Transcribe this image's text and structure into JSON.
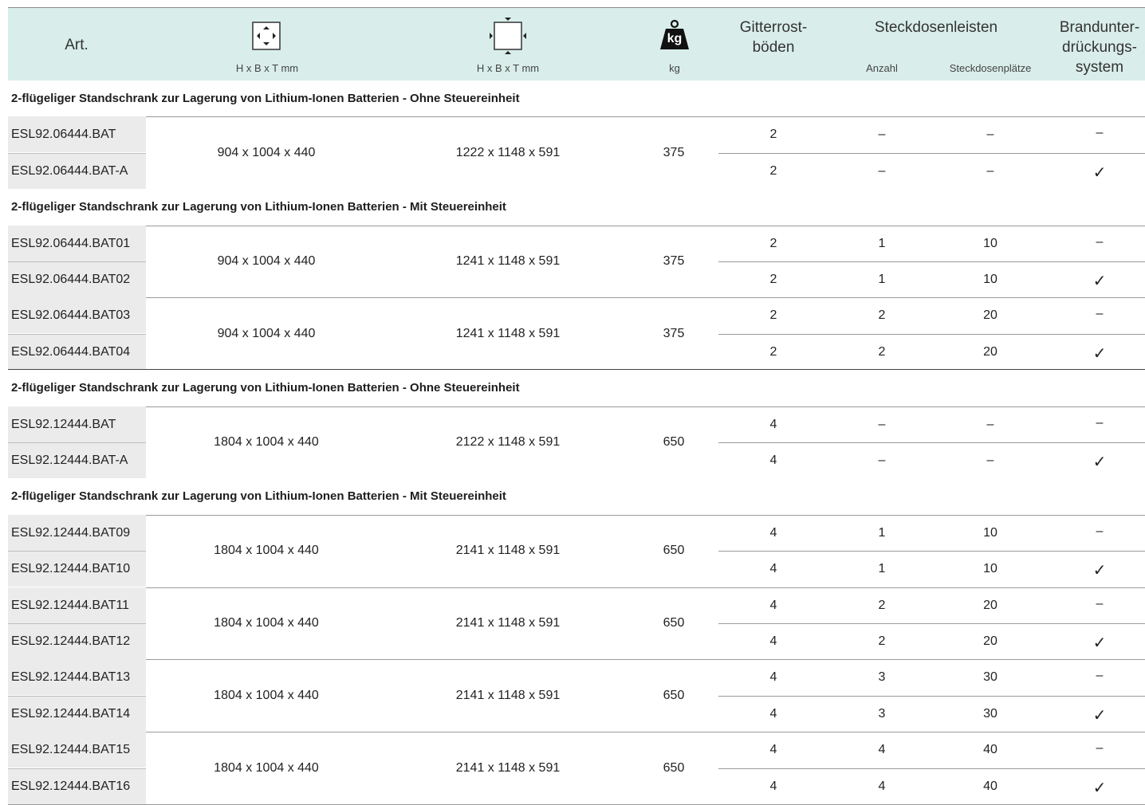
{
  "header": {
    "art": "Art.",
    "dim_inner_label": "H x B x T mm",
    "dim_outer_label": "H x B x T mm",
    "weight_icon_text": "kg",
    "weight_label": "kg",
    "shelves_line1": "Gitterrost-",
    "shelves_line2": "böden",
    "sockets_title": "Steckdosenleisten",
    "sockets_count": "Anzahl",
    "sockets_places": "Steckdosenplätze",
    "fire_line1": "Brandunter-",
    "fire_line2": "drückungs-",
    "fire_line3": "system"
  },
  "groups": [
    "2-flügeliger Standschrank zur Lagerung von Lithium-Ionen Batterien - Ohne Steuereinheit",
    "2-flügeliger Standschrank zur Lagerung von Lithium-Ionen Batterien - Mit Steuereinheit",
    "2-flügeliger Standschrank zur Lagerung von Lithium-Ionen Batterien - Ohne Steuereinheit",
    "2-flügeliger Standschrank zur Lagerung von Lithium-Ionen Batterien - Mit Steuereinheit"
  ],
  "pairs": [
    {
      "inner": "904 x 1004 x 440",
      "outer": "1222 x 1148 x 591",
      "weight": "375"
    },
    {
      "inner": "904 x 1004 x 440",
      "outer": "1241 x 1148 x 591",
      "weight": "375"
    },
    {
      "inner": "904 x 1004 x 440",
      "outer": "1241 x 1148 x 591",
      "weight": "375"
    },
    {
      "inner": "1804 x 1004 x 440",
      "outer": "2122 x 1148 x 591",
      "weight": "650"
    },
    {
      "inner": "1804 x 1004 x 440",
      "outer": "2141 x 1148 x 591",
      "weight": "650"
    },
    {
      "inner": "1804 x 1004 x 440",
      "outer": "2141 x 1148 x 591",
      "weight": "650"
    },
    {
      "inner": "1804 x 1004 x 440",
      "outer": "2141 x 1148 x 591",
      "weight": "650"
    },
    {
      "inner": "1804 x 1004 x 440",
      "outer": "2141 x 1148 x 591",
      "weight": "650"
    }
  ],
  "rows": [
    {
      "art": "ESL92.06444.BAT",
      "shelves": "2",
      "count": "–",
      "places": "–",
      "fire": "–"
    },
    {
      "art": "ESL92.06444.BAT-A",
      "shelves": "2",
      "count": "–",
      "places": "–",
      "fire": "✓"
    },
    {
      "art": "ESL92.06444.BAT01",
      "shelves": "2",
      "count": "1",
      "places": "10",
      "fire": "–"
    },
    {
      "art": "ESL92.06444.BAT02",
      "shelves": "2",
      "count": "1",
      "places": "10",
      "fire": "✓"
    },
    {
      "art": "ESL92.06444.BAT03",
      "shelves": "2",
      "count": "2",
      "places": "20",
      "fire": "–"
    },
    {
      "art": "ESL92.06444.BAT04",
      "shelves": "2",
      "count": "2",
      "places": "20",
      "fire": "✓"
    },
    {
      "art": "ESL92.12444.BAT",
      "shelves": "4",
      "count": "–",
      "places": "–",
      "fire": "–"
    },
    {
      "art": "ESL92.12444.BAT-A",
      "shelves": "4",
      "count": "–",
      "places": "–",
      "fire": "✓"
    },
    {
      "art": "ESL92.12444.BAT09",
      "shelves": "4",
      "count": "1",
      "places": "10",
      "fire": "–"
    },
    {
      "art": "ESL92.12444.BAT10",
      "shelves": "4",
      "count": "1",
      "places": "10",
      "fire": "✓"
    },
    {
      "art": "ESL92.12444.BAT11",
      "shelves": "4",
      "count": "2",
      "places": "20",
      "fire": "–"
    },
    {
      "art": "ESL92.12444.BAT12",
      "shelves": "4",
      "count": "2",
      "places": "20",
      "fire": "✓"
    },
    {
      "art": "ESL92.12444.BAT13",
      "shelves": "4",
      "count": "3",
      "places": "30",
      "fire": "–"
    },
    {
      "art": "ESL92.12444.BAT14",
      "shelves": "4",
      "count": "3",
      "places": "30",
      "fire": "✓"
    },
    {
      "art": "ESL92.12444.BAT15",
      "shelves": "4",
      "count": "4",
      "places": "40",
      "fire": "–"
    },
    {
      "art": "ESL92.12444.BAT16",
      "shelves": "4",
      "count": "4",
      "places": "40",
      "fire": "✓"
    }
  ]
}
